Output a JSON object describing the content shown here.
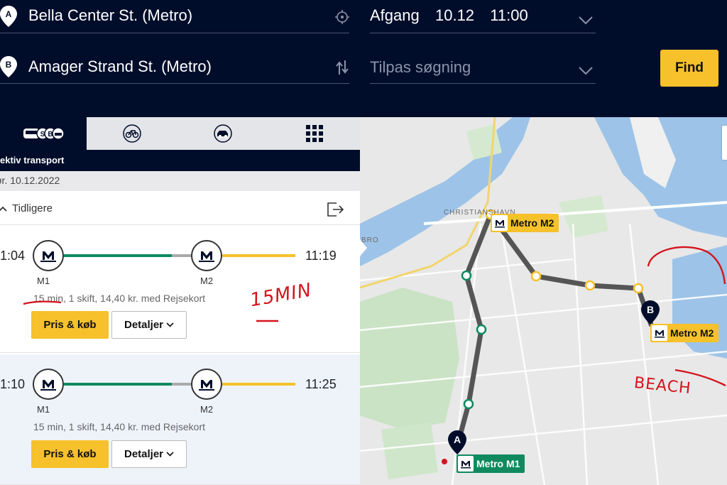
{
  "header": {
    "from": {
      "marker": "A",
      "value": "Bella Center St. (Metro)"
    },
    "to": {
      "marker": "B",
      "value": "Amager Strand St. (Metro)"
    },
    "departure": {
      "mode": "Afgang",
      "date": "10.12",
      "time": "11:00"
    },
    "refine_placeholder": "Tilpas søgning",
    "find_label": "Find"
  },
  "modes": {
    "active_label": "ektiv transport",
    "tabs": [
      "public-transport",
      "bike",
      "car",
      "more"
    ]
  },
  "date_bar": "ør. 10.12.2022",
  "earlier_label": "Tidligere",
  "trips": [
    {
      "depart": "1:04",
      "arrive": "11:19",
      "line1": "M1",
      "line2": "M2",
      "duration": "15 min",
      "info_rest": ", 1 skift, 14,40 kr. med Rejsekort",
      "buy_label": "Pris & køb",
      "details_label": "Detaljer"
    },
    {
      "depart": "1:10",
      "arrive": "11:25",
      "line1": "M1",
      "line2": "M2",
      "duration": "15 min",
      "info_rest": ", 1 skift, 14,40 kr. med Rejsekort",
      "buy_label": "Pris & køb",
      "details_label": "Detaljer"
    }
  ],
  "map": {
    "area_label": "CHRISTIANSHAVN",
    "area_label_2": "BRO",
    "stop_a_label": "Metro M1",
    "stop_b_label": "Metro M2",
    "transfer_label": "Metro M2",
    "marker_a": "A",
    "marker_b": "B"
  },
  "annotations": {
    "note_time": "15MIN",
    "note_beach": "BEACH"
  },
  "colors": {
    "navy": "#000d2a",
    "yellow": "#f6c12b",
    "m1_green": "#0f8a5f",
    "m2_yellow": "#f6c12b",
    "ink_red": "#d4141c"
  }
}
